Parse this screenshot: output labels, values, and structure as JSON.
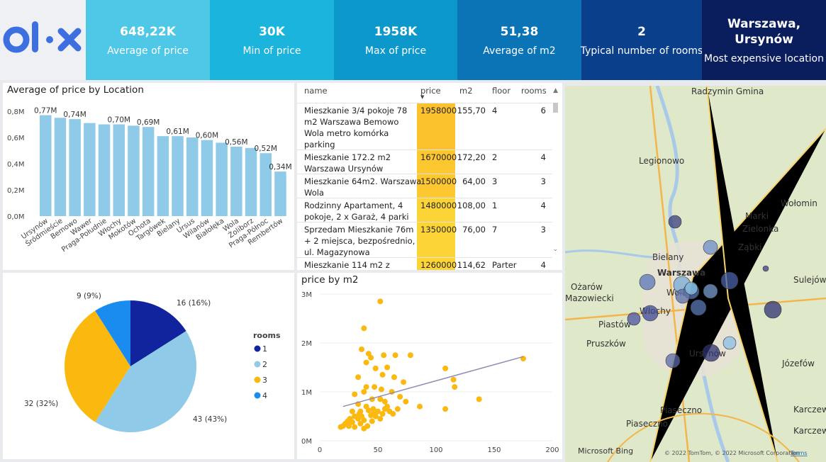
{
  "header": {
    "logo_text": "olx",
    "kpis": [
      {
        "value": "648,22K",
        "label": "Average of price",
        "color": "#4ec8e6"
      },
      {
        "value": "30K",
        "label": "Min of price",
        "color": "#1ab4dc"
      },
      {
        "value": "1958K",
        "label": "Max of price",
        "color": "#0d98cc"
      },
      {
        "value": "51,38",
        "label": "Average of m2",
        "color": "#0a74b6"
      },
      {
        "value": "2",
        "label": "Typical number of rooms",
        "color": "#0a3f8c"
      },
      {
        "value": "Warszawa, Ursynów",
        "label": "Most expensive location",
        "color": "#0a1e5e"
      }
    ]
  },
  "bar_panel": {
    "title": "Average of price by Location"
  },
  "table": {
    "headers": [
      "name",
      "price",
      "m2",
      "floor",
      "rooms"
    ],
    "rows": [
      {
        "name": [
          "Mieszkanie 3/4 pokoje 78",
          "m2 Warszawa Bemowo",
          "Wola metro komórka",
          "parking"
        ],
        "price": "1958000",
        "m2": "155,70",
        "floor": "4",
        "rooms": "6"
      },
      {
        "name": [
          "Mieszkanie 172.2 m2",
          "Warszawa Ursynów"
        ],
        "price": "1670000",
        "m2": "172,20",
        "floor": "2",
        "rooms": "4"
      },
      {
        "name": [
          "Mieszkanie 64m2. Warszawa",
          "Wola"
        ],
        "price": "1500000",
        "m2": "64,00",
        "floor": "3",
        "rooms": "3"
      },
      {
        "name": [
          "Rodzinny Apartament, 4",
          "pokoje, 2 x Garaż, 4 parki"
        ],
        "price": "1480000",
        "m2": "108,00",
        "floor": "1",
        "rooms": "4"
      },
      {
        "name": [
          "Sprzedam Mieszkanie 76m",
          "+ 2 miejsca, bezpośrednio,",
          "ul. Magazynowa"
        ],
        "price": "1350000",
        "m2": "76,00",
        "floor": "7",
        "rooms": "3"
      },
      {
        "name": [
          "Mieszkanie 114 m2 z"
        ],
        "price": "1260000",
        "m2": "114,62",
        "floor": "Parter",
        "rooms": "4"
      }
    ]
  },
  "scatter_panel": {
    "title": "price by m2"
  },
  "pie_panel": {
    "legend_title": "rooms"
  },
  "map": {
    "labels": [
      "Radzymin Gmina",
      "Legionowo",
      "Marki",
      "Zielonka",
      "Wołomin",
      "Ząbki",
      "Bielany",
      "Warszawa",
      "Sulejów",
      "Ożarów",
      "Mazowiecki",
      "Wola",
      "Włochy",
      "Piastów",
      "Pruszków",
      "Ursynów",
      "Józefów",
      "Piaseczno",
      "Piaseczno",
      "Karczew",
      "Karczew"
    ],
    "attribution": "© 2022 TomTom, © 2022 Microsoft Corporation",
    "terms": "Terms",
    "bing": "Microsoft Bing"
  },
  "chart_data": [
    {
      "type": "bar",
      "title": "Average of price by Location",
      "categories": [
        "Ursynów",
        "Śródmieście",
        "Bemowo",
        "Wawer",
        "Praga-Południe",
        "Włochy",
        "Mokotów",
        "Ochota",
        "Targówek",
        "Bielany",
        "Ursus",
        "Wilanów",
        "Białołęka",
        "Wola",
        "Żoliborz",
        "Praga-Północ",
        "Rembertów"
      ],
      "values": [
        0.77,
        0.75,
        0.74,
        0.71,
        0.7,
        0.7,
        0.69,
        0.68,
        0.61,
        0.61,
        0.6,
        0.58,
        0.56,
        0.53,
        0.52,
        0.48,
        0.34
      ],
      "data_labels": [
        "0,77M",
        "",
        "0,74M",
        "",
        "",
        "0,70M",
        "",
        "0,69M",
        "",
        "0,61M",
        "",
        "0,60M",
        "",
        "0,56M",
        "",
        "0,52M",
        "",
        "0,34M"
      ],
      "label_map": {
        "0": "0,77M",
        "2": "0,74M",
        "5": "0,70M",
        "7": "0,69M",
        "9": "0,61M",
        "11": "0,60M",
        "13": "0,56M",
        "15": "0,52M",
        "16": "0,34M"
      },
      "yticks": [
        "0,0M",
        "0,2M",
        "0,4M",
        "0,6M",
        "0,8M"
      ],
      "ylim": [
        0,
        0.8
      ],
      "color": "#8fcbe8"
    },
    {
      "type": "pie",
      "legend_title": "rooms",
      "slices": [
        {
          "name": "1",
          "value": 16,
          "label": "16 (16%)",
          "color": "#12239e"
        },
        {
          "name": "2",
          "value": 43,
          "label": "43 (43%)",
          "color": "#8fcbe8"
        },
        {
          "name": "3",
          "value": 32,
          "label": "32 (32%)",
          "color": "#fbb80f"
        },
        {
          "name": "4",
          "value": 9,
          "label": "9 (9%)",
          "color": "#1a8cf0"
        }
      ]
    },
    {
      "type": "scatter",
      "title": "price by m2",
      "xticks": [
        "0",
        "50",
        "100",
        "150",
        "200"
      ],
      "yticks": [
        "0M",
        "1M",
        "2M",
        "3M"
      ],
      "xlim": [
        0,
        200
      ],
      "ylim": [
        0,
        3
      ],
      "color": "#fbb80f",
      "trend": [
        [
          20,
          0.7
        ],
        [
          175,
          1.72
        ]
      ],
      "points": [
        [
          52,
          2.85
        ],
        [
          38,
          2.3
        ],
        [
          36,
          1.87
        ],
        [
          42,
          1.78
        ],
        [
          44,
          1.7
        ],
        [
          55,
          1.75
        ],
        [
          78,
          1.75
        ],
        [
          65,
          1.75
        ],
        [
          40,
          1.6
        ],
        [
          58,
          1.5
        ],
        [
          48,
          1.48
        ],
        [
          33,
          1.3
        ],
        [
          54,
          1.35
        ],
        [
          64,
          1.3
        ],
        [
          108,
          1.48
        ],
        [
          72,
          1.2
        ],
        [
          115,
          1.25
        ],
        [
          116,
          1.1
        ],
        [
          40,
          1.1
        ],
        [
          47,
          1.1
        ],
        [
          53,
          1.05
        ],
        [
          38,
          1.0
        ],
        [
          62,
          1.0
        ],
        [
          69,
          0.9
        ],
        [
          30,
          0.95
        ],
        [
          45,
          0.85
        ],
        [
          52,
          0.85
        ],
        [
          56,
          0.8
        ],
        [
          74,
          0.8
        ],
        [
          137,
          0.85
        ],
        [
          58,
          0.7
        ],
        [
          67,
          0.65
        ],
        [
          86,
          0.7
        ],
        [
          108,
          0.65
        ],
        [
          175,
          1.68
        ],
        [
          33,
          0.75
        ],
        [
          40,
          0.7
        ],
        [
          46,
          0.65
        ],
        [
          28,
          0.6
        ],
        [
          35,
          0.6
        ],
        [
          42,
          0.62
        ],
        [
          50,
          0.6
        ],
        [
          54,
          0.55
        ],
        [
          60,
          0.6
        ],
        [
          63,
          0.55
        ],
        [
          30,
          0.5
        ],
        [
          36,
          0.5
        ],
        [
          44,
          0.52
        ],
        [
          48,
          0.5
        ],
        [
          26,
          0.45
        ],
        [
          33,
          0.45
        ],
        [
          38,
          0.42
        ],
        [
          45,
          0.4
        ],
        [
          52,
          0.45
        ],
        [
          22,
          0.35
        ],
        [
          28,
          0.38
        ],
        [
          35,
          0.35
        ],
        [
          41,
          0.3
        ],
        [
          20,
          0.3
        ],
        [
          25,
          0.3
        ],
        [
          30,
          0.28
        ],
        [
          38,
          0.25
        ],
        [
          18,
          0.28
        ],
        [
          46,
          0.55
        ],
        [
          56,
          0.65
        ],
        [
          34,
          0.55
        ],
        [
          24,
          0.4
        ]
      ]
    }
  ]
}
